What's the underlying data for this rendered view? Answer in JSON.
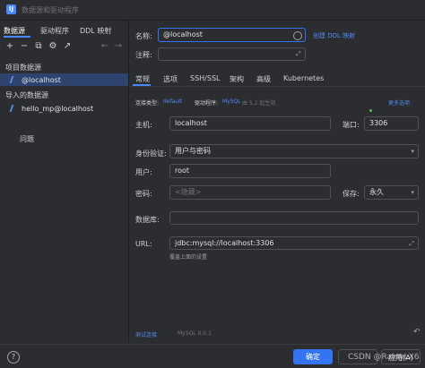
{
  "window": {
    "title": "数据源和驱动程序"
  },
  "left_tabs": [
    "数据源",
    "驱动程序",
    "DDL 映射"
  ],
  "toolbar_icons": [
    "add-icon",
    "remove-icon",
    "copy-icon",
    "settings-icon",
    "export-icon",
    "back-icon",
    "forward-icon"
  ],
  "sections": {
    "project": {
      "label": "项目数据源",
      "items": [
        "@localhost"
      ]
    },
    "imported": {
      "label": "导入的数据源",
      "items": [
        "hello_mp@localhost"
      ]
    },
    "problems": "问题"
  },
  "form": {
    "name_label": "名称:",
    "name_value": "@localhost",
    "create_ddl_link": "创建 DDL 映射",
    "comment_label": "注释:",
    "tabs": [
      "常规",
      "选项",
      "SSH/SSL",
      "架构",
      "高级",
      "Kubernetes"
    ],
    "conn_type_label": "连接类型:",
    "conn_type_value": "default",
    "driver_label": "驱动程序:",
    "driver_value": "MySQL",
    "driver_version": "由 5.2 起生效",
    "more_options": "更多选项",
    "host_label": "主机:",
    "host_value": "localhost",
    "port_label": "端口:",
    "port_value": "3306",
    "auth_label": "身份验证:",
    "auth_value": "用户与密码",
    "user_label": "用户:",
    "user_value": "root",
    "password_label": "密码:",
    "password_placeholder": "<隐藏>",
    "save_label": "保存:",
    "save_value": "永久",
    "database_label": "数据库:",
    "database_value": "",
    "url_label": "URL:",
    "url_value": "jdbc:mysql://localhost:3306",
    "url_hint": "覆盖上面的设置"
  },
  "footer": {
    "test_link": "测试连接",
    "mysql_version": "MySQL 9.0.1",
    "ok": "确定",
    "apply": "应用(A)",
    "watermark": "CSDN @RainyLX6"
  }
}
